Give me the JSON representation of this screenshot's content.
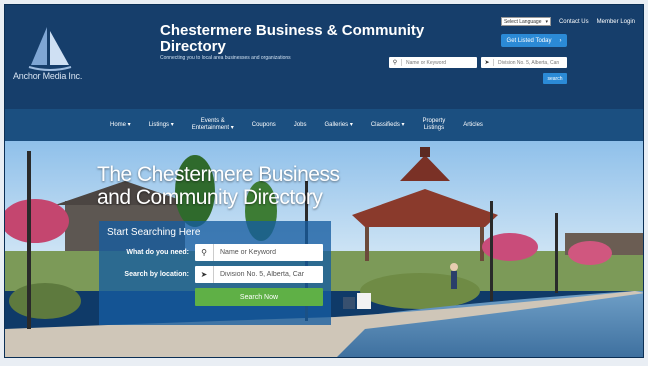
{
  "logo": {
    "company": "Anchor Media Inc."
  },
  "brand": {
    "title_line1": "Chestermere Business & Community",
    "title_line2": "Directory",
    "tagline": "Connecting you to local area businesses and organizations"
  },
  "top_bar": {
    "language_select": "Select Language",
    "links": [
      "Contact Us",
      "Member Login"
    ],
    "get_listed": "Get Listed Today",
    "search_placeholder": "Name or Keyword",
    "location_value": "Division No. 5, Alberta, Can",
    "search_button": "search"
  },
  "nav": {
    "items": [
      {
        "label": "Home ▾"
      },
      {
        "label": "Listings ▾"
      },
      {
        "label": "Events &",
        "label2": "Entertainment ▾"
      },
      {
        "label": "Coupons"
      },
      {
        "label": "Jobs"
      },
      {
        "label": "Galleries ▾"
      },
      {
        "label": "Classifieds ▾"
      },
      {
        "label": "Property",
        "label2": "Listings"
      },
      {
        "label": "Articles"
      }
    ]
  },
  "hero": {
    "title_line1": "The Chestermere Business",
    "title_line2": "and Community Directory",
    "search_title": "Start Searching Here",
    "need_label": "What do you need:",
    "need_placeholder": "Name or Keyword",
    "location_label": "Search by location:",
    "location_value": "Division No. 5, Alberta, Car",
    "button_label": "Search Now"
  },
  "colors": {
    "header_bg": "#163e6b",
    "nav_bg": "#1b4f80",
    "accent_blue": "#2b8ad6",
    "search_button_green": "#5fb046"
  }
}
